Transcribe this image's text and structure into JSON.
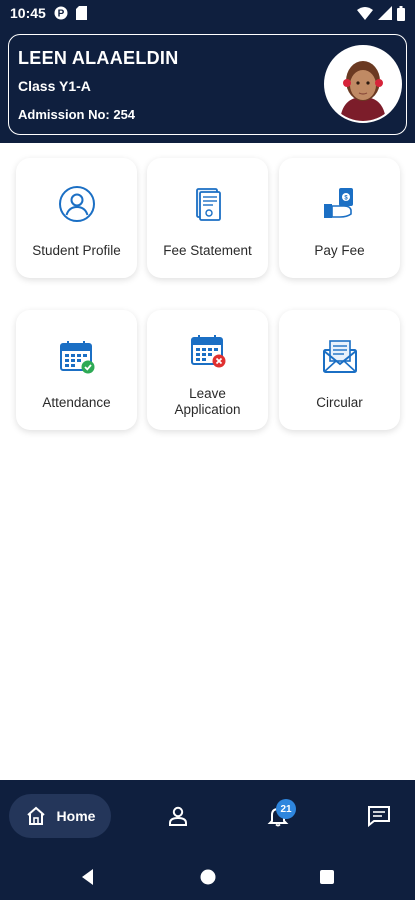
{
  "status_bar": {
    "time": "10:45",
    "icons": [
      "cloud-p-icon",
      "sim-card-icon",
      "wifi-icon",
      "signal-icon",
      "battery-icon"
    ]
  },
  "profile": {
    "name": "LEEN ALAAELDIN",
    "class_text": "Class Y1-A",
    "admission_text": "Admission No: 254"
  },
  "tiles": [
    {
      "label": "Student Profile",
      "icon": "student-profile-icon"
    },
    {
      "label": "Fee Statement",
      "icon": "fee-statement-icon"
    },
    {
      "label": "Pay Fee",
      "icon": "pay-fee-icon"
    },
    {
      "label": "Attendance",
      "icon": "attendance-icon"
    },
    {
      "label": "Leave Application",
      "icon": "leave-application-icon"
    },
    {
      "label": "Circular",
      "icon": "circular-icon"
    }
  ],
  "bottom_nav": {
    "home_label": "Home",
    "notification_count": "21",
    "items": [
      "home-icon",
      "profile-icon",
      "bell-icon",
      "chat-icon"
    ]
  },
  "colors": {
    "header_bg": "#0f1f3e",
    "nav_pill": "#24365a",
    "icon_blue": "#1b6fc4",
    "badge": "#2e86de"
  }
}
